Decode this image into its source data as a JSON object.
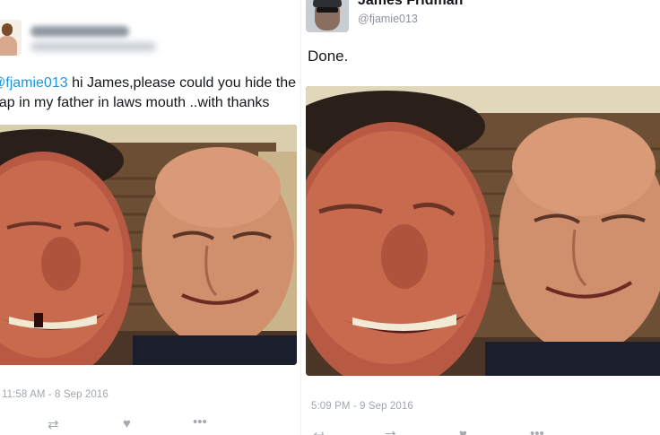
{
  "left_tweet": {
    "text_mention": "@fjamie013",
    "text_body": " hi James,please could you hide the gap in my father in laws mouth ..with thanks",
    "timestamp": "11:58 AM - 8 Sep 2016",
    "photo_label": "Original selfie: smiling man with a missing front tooth next to a bald man",
    "actions": {
      "retweet_icon": "retweet-icon",
      "like_icon": "heart-icon",
      "more_icon": "more-dots-icon"
    }
  },
  "right_tweet": {
    "name": "James Fridman",
    "handle": "@fjamie013",
    "text": "Done.",
    "timestamp": "5:09 PM - 9 Sep 2016",
    "photo_label": "Edited selfie: the gap in the teeth filled in",
    "actions": {
      "reply_icon": "reply-icon",
      "retweet_icon": "retweet-icon",
      "like_icon": "heart-icon",
      "more_icon": "more-dots-icon"
    }
  },
  "colors": {
    "mention": "#1b95e0",
    "meta_gray": "#a0a7ad",
    "text": "#14171a"
  }
}
